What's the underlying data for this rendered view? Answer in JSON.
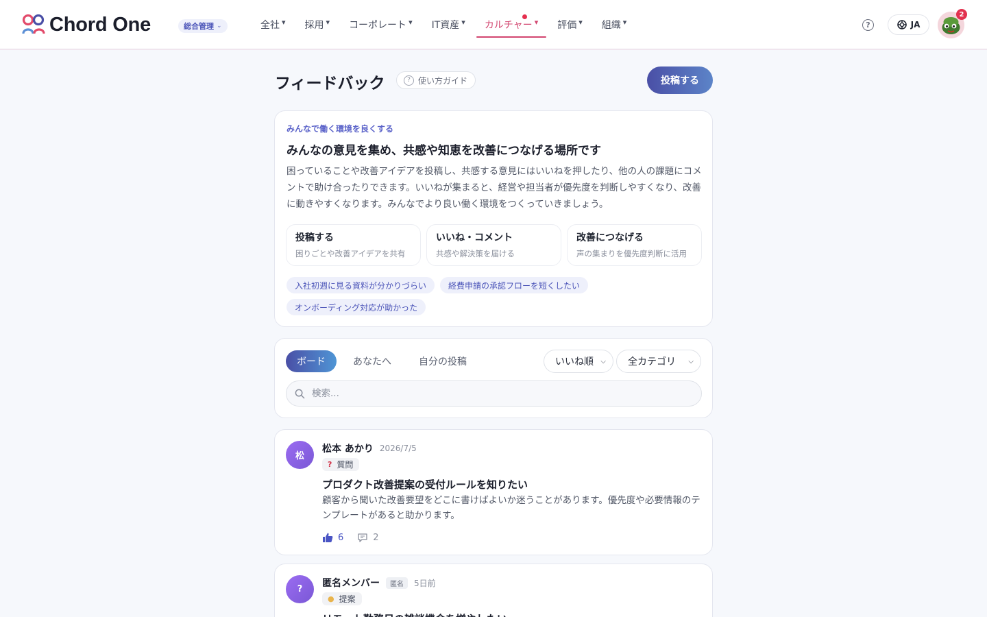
{
  "brand": {
    "name": "Chord One",
    "admin_label": "総合管理",
    "accent": "#4a4fa6",
    "active_color": "#d2456f"
  },
  "nav": {
    "items": [
      {
        "label": "全社",
        "arrow": "▾"
      },
      {
        "label": "採用",
        "arrow": "▾"
      },
      {
        "label": "コーポレート",
        "arrow": "▾"
      },
      {
        "label": "IT資産",
        "arrow": "▾"
      },
      {
        "label": "カルチャー",
        "arrow": "▾"
      },
      {
        "label": "評価",
        "arrow": "▾"
      },
      {
        "label": "組織",
        "arrow": "▾"
      }
    ],
    "active_index": 4
  },
  "header_right": {
    "help_icon": "help-circle-icon",
    "lang_label": "JA",
    "notification_count": "2"
  },
  "page": {
    "title": "フィードバック",
    "guide_label": "使い方ガイド",
    "post_button": "投稿する"
  },
  "intro": {
    "eyebrow": "みんなで働く環境を良くする",
    "title": "みんなの意見を集め、共感や知恵を改善につなげる場所です",
    "body": "困っていることや改善アイデアを投稿し、共感する意見にはいいねを押したり、他の人の課題にコメントで助け合ったりできます。いいねが集まると、経営や担当者が優先度を判断しやすくなり、改善に動きやすくなります。みんなでより良い働く環境をつくっていきましょう。",
    "steps": [
      {
        "title": "投稿する",
        "sub": "困りごとや改善アイデアを共有"
      },
      {
        "title": "いいね・コメント",
        "sub": "共感や解決策を届ける"
      },
      {
        "title": "改善につなげる",
        "sub": "声の集まりを優先度判断に活用"
      }
    ],
    "tags": [
      "入社初週に見る資料が分かりづらい",
      "経費申請の承認フローを短くしたい",
      "オンボーディング対応が助かった"
    ]
  },
  "filter": {
    "tabs": [
      "ボード",
      "あなたへ",
      "自分の投稿"
    ],
    "active_tab": 0,
    "sort_value": "いいね順",
    "category_value": "全カテゴリ",
    "search_placeholder": "検索..."
  },
  "posts": [
    {
      "avatar": "松",
      "name": "松本 あかり",
      "anon_badge": "",
      "date": "2026/7/5",
      "category_icon": "❓",
      "category": "質問",
      "title": "プロダクト改善提案の受付ルールを知りたい",
      "body": "顧客から聞いた改善要望をどこに書けばよいか迷うことがあります。優先度や必要情報のテンプレートがあると助かります。",
      "likes": "6",
      "comments": "2"
    },
    {
      "avatar": "?",
      "name": "匿名メンバー",
      "anon_badge": "匿名",
      "date": "5日前",
      "category_icon": "💡",
      "category": "提案",
      "title": "リモート勤務日の雑談機会を増やしたい",
      "body": "",
      "likes": "",
      "comments": ""
    }
  ]
}
